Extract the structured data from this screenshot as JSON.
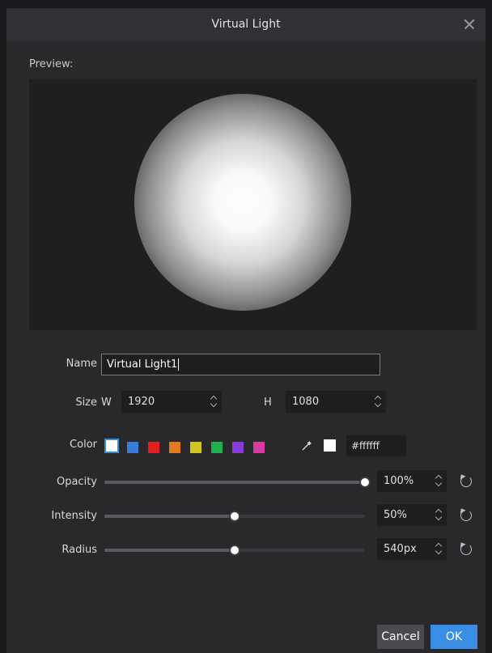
{
  "dialog": {
    "title": "Virtual Light"
  },
  "preview": {
    "label": "Preview:"
  },
  "name": {
    "label": "Name",
    "value": "Virtual Light1"
  },
  "size": {
    "label": "Size",
    "w_label": "W",
    "w_value": "1920",
    "h_label": "H",
    "h_value": "1080"
  },
  "color": {
    "label": "Color",
    "swatches": [
      {
        "name": "white",
        "hex": "#ffffff",
        "selected": true
      },
      {
        "name": "blue",
        "hex": "#3a7bd5"
      },
      {
        "name": "red",
        "hex": "#e02020"
      },
      {
        "name": "orange",
        "hex": "#e07a20"
      },
      {
        "name": "yellow",
        "hex": "#d4c420"
      },
      {
        "name": "green",
        "hex": "#20b050"
      },
      {
        "name": "purple",
        "hex": "#8a3ad8"
      },
      {
        "name": "pink",
        "hex": "#d83aa0"
      }
    ],
    "current_hex": "#ffffff",
    "hex_text": "#ffffff"
  },
  "opacity": {
    "label": "Opacity",
    "value": "100%",
    "fraction": 1.0
  },
  "intensity": {
    "label": "Intensity",
    "value": "50%",
    "fraction": 0.5
  },
  "radius": {
    "label": "Radius",
    "value": "540px",
    "fraction": 0.5
  },
  "buttons": {
    "cancel": "Cancel",
    "ok": "OK"
  },
  "colors": {
    "accent": "#3a8ee6",
    "background": "#29292c"
  }
}
